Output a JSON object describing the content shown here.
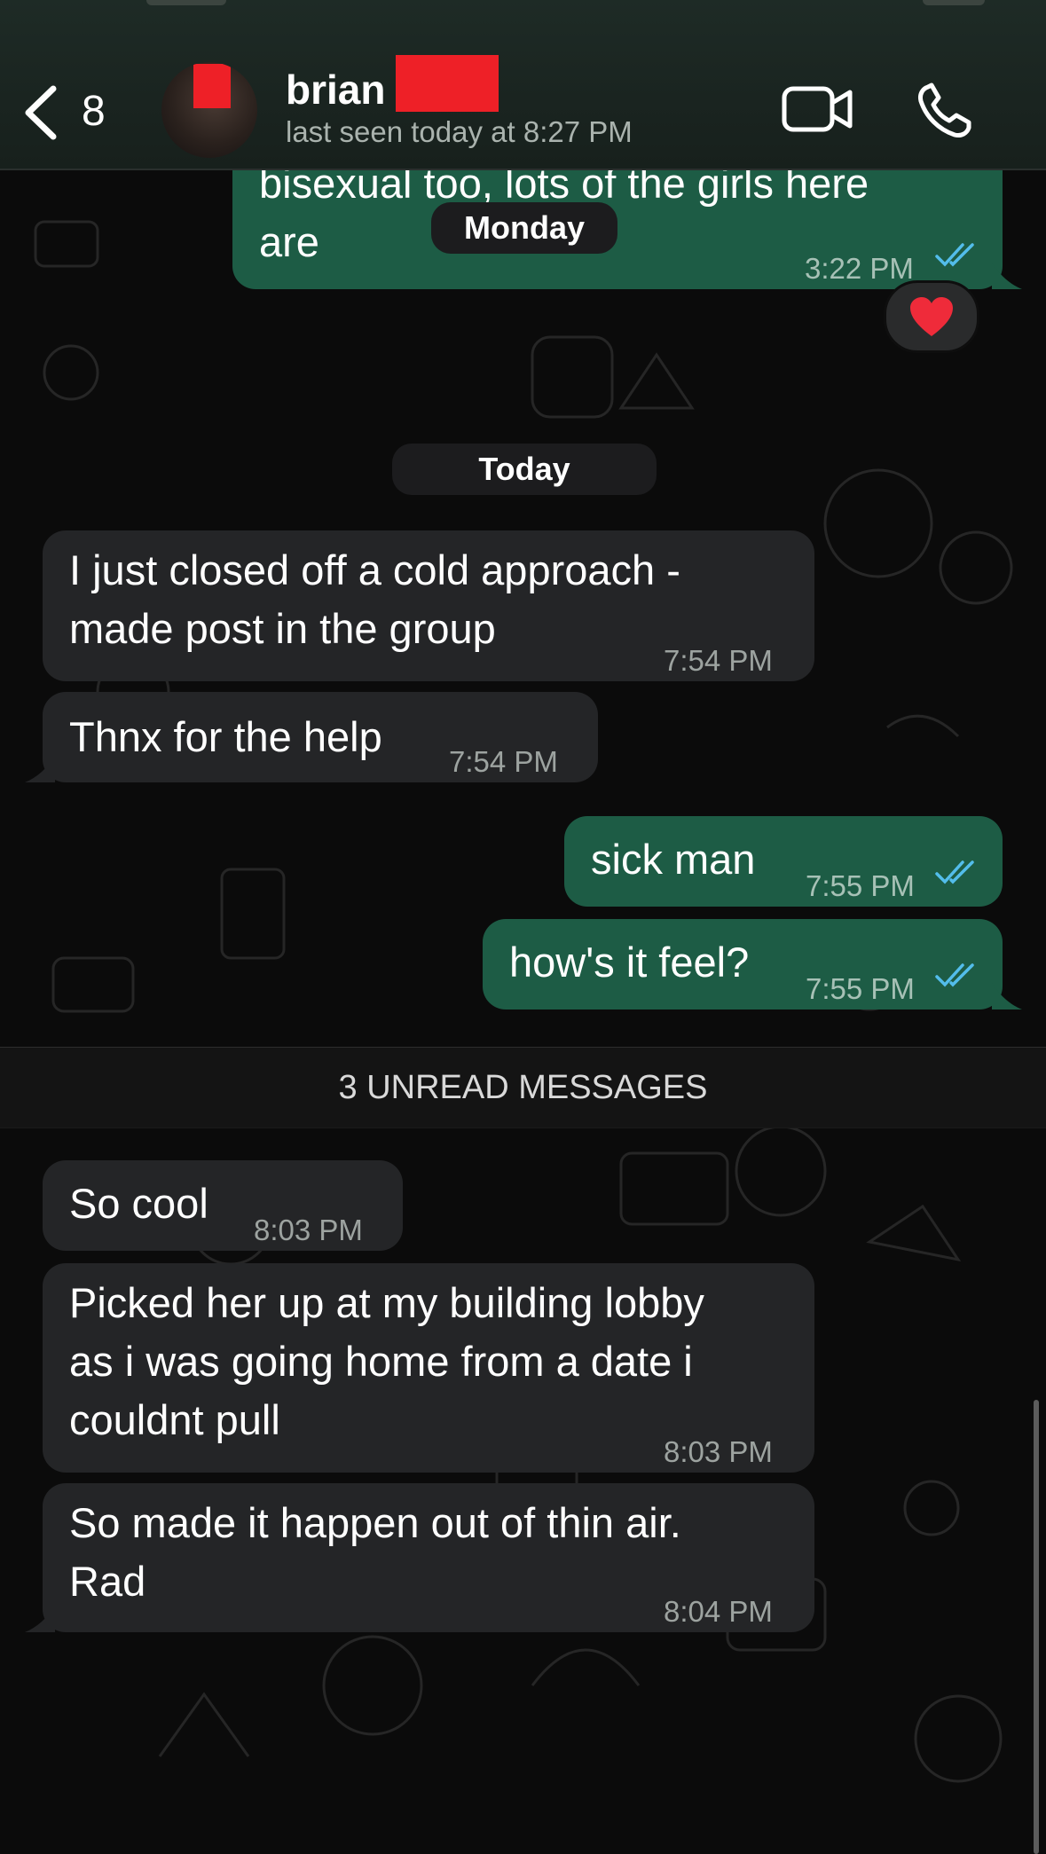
{
  "header": {
    "back_count": "8",
    "contact_name": "brian",
    "last_seen": "last seen today at 8:27 PM"
  },
  "colors": {
    "incoming_bubble": "#242527",
    "outgoing_bubble": "#1d5c45",
    "read_ticks": "#53bdeb",
    "redaction": "#ee2027"
  },
  "icons": [
    "chevron-left-icon",
    "video-camera-icon",
    "phone-icon",
    "double-check-icon",
    "heart-emoji"
  ],
  "messages": [
    {
      "dir": "out",
      "text": "bisexual too, lots of the girls here\nare",
      "time": "3:22 PM",
      "read": true,
      "reaction": "❤️"
    },
    {
      "dir": "in",
      "text": "I just closed off a cold approach -\nmade post in the group",
      "time": "7:54 PM"
    },
    {
      "dir": "in",
      "text": "Thnx for the help",
      "time": "7:54 PM"
    },
    {
      "dir": "out",
      "text": "sick man",
      "time": "7:55 PM",
      "read": true
    },
    {
      "dir": "out",
      "text": "how's it feel?",
      "time": "7:55 PM",
      "read": true
    },
    {
      "dir": "in",
      "text": "So cool",
      "time": "8:03 PM"
    },
    {
      "dir": "in",
      "text": "Picked her up at my building lobby\nas i was going home from a date i\ncouldnt pull",
      "time": "8:03 PM"
    },
    {
      "dir": "in",
      "text": "So made it happen out of thin air.\nRad",
      "time": "8:04 PM"
    }
  ],
  "date_labels": {
    "floating": "Monday",
    "today": "Today"
  },
  "unread_banner": "3 UNREAD MESSAGES"
}
